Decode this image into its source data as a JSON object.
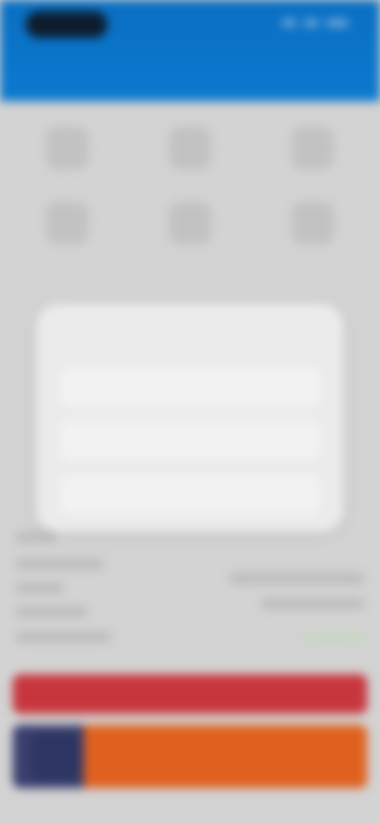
{
  "status": {
    "time": "",
    "indicators": [
      "signal",
      "wifi",
      "battery"
    ]
  },
  "header": {
    "title": ""
  },
  "grid": {
    "items": [
      {
        "label": "",
        "icon": "app-icon"
      },
      {
        "label": "",
        "icon": "app-icon"
      },
      {
        "label": "",
        "icon": "app-icon"
      },
      {
        "label": "",
        "icon": "app-icon"
      },
      {
        "label": "",
        "icon": "app-icon"
      },
      {
        "label": "",
        "icon": "app-icon"
      }
    ]
  },
  "dialog": {
    "title": "",
    "options": [
      "",
      "",
      ""
    ]
  },
  "banner": {
    "red_label": "",
    "ad_label": ""
  },
  "colors": {
    "header": "#0b79d0",
    "banner": "#c7363c",
    "ad": "#e0611f"
  }
}
